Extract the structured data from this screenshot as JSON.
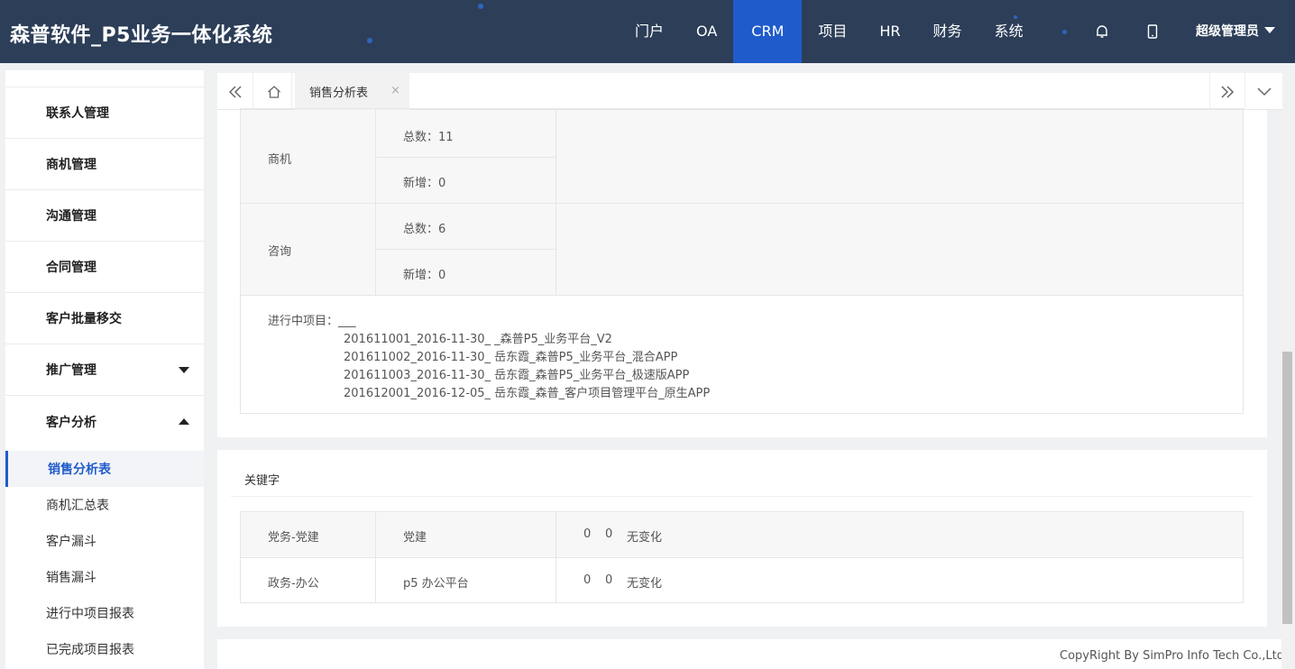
{
  "app": {
    "title": "森普软件_P5业务一体化系统"
  },
  "nav": {
    "items": [
      "门户",
      "OA",
      "CRM",
      "项目",
      "HR",
      "财务",
      "系统"
    ],
    "active": "CRM",
    "user": "超级管理员"
  },
  "sidebar": {
    "items": [
      {
        "label": "联系人管理"
      },
      {
        "label": "商机管理"
      },
      {
        "label": "沟通管理"
      },
      {
        "label": "合同管理"
      },
      {
        "label": "客户批量移交"
      },
      {
        "label": "推广管理"
      },
      {
        "label": "客户分析"
      }
    ],
    "subitems": [
      {
        "label": "销售分析表"
      },
      {
        "label": "商机汇总表"
      },
      {
        "label": "客户漏斗"
      },
      {
        "label": "销售漏斗"
      },
      {
        "label": "进行中项目报表"
      },
      {
        "label": "已完成项目报表"
      }
    ]
  },
  "tabs": {
    "active": "销售分析表"
  },
  "summary": {
    "rows": [
      {
        "category": "商机",
        "total": "总数：11",
        "new": "新增：0"
      },
      {
        "category": "咨询",
        "total": "总数：6",
        "new": "新增：0"
      }
    ],
    "projects_label": "进行中项目：___",
    "projects": [
      "201611001_2016-11-30_ _森普P5_业务平台_V2",
      "201611002_2016-11-30_ 岳东霞_森普P5_业务平台_混合APP",
      "201611003_2016-11-30_ 岳东霞_森普P5_业务平台_极速版APP",
      "201612001_2016-12-05_ 岳东霞_森普_客户项目管理平台_原生APP"
    ]
  },
  "keywords": {
    "title": "关键字",
    "rows": [
      {
        "group": "党务-党建",
        "keyword": "党建",
        "a": "0",
        "b": "0",
        "status": "无变化"
      },
      {
        "group": "政务-办公",
        "keyword": "p5 办公平台",
        "a": "0",
        "b": "0",
        "status": "无变化"
      }
    ]
  },
  "footer": {
    "copyright": "CopyRight By SimPro Info Tech Co.,Ltd"
  }
}
